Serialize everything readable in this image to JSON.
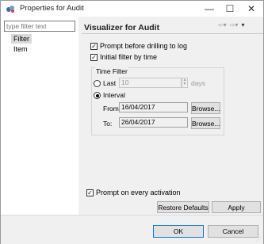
{
  "window": {
    "title": "Properties for Audit",
    "controls": {
      "close_glyph": "✕",
      "maximize_glyph": "☐",
      "minimize_glyph": "—"
    }
  },
  "sidebar": {
    "filter_placeholder": "type filter text",
    "items": [
      {
        "label": "Filter",
        "selected": true
      },
      {
        "label": "Item",
        "selected": false
      }
    ]
  },
  "page": {
    "title": "Visualizer for Audit",
    "options": [
      {
        "label": "Prompt before drilling to log",
        "checked": true
      },
      {
        "label": "Initial filter by time",
        "checked": true
      }
    ],
    "time_filter": {
      "group_label": "Time Filter",
      "last": {
        "label": "Last",
        "selected": false,
        "value": "10",
        "unit": "days"
      },
      "interval": {
        "label": "Interval",
        "selected": true
      },
      "from": {
        "label": "From:",
        "value": "16/04/2017",
        "browse_label": "Browse..."
      },
      "to": {
        "label": "To:",
        "value": "26/04/2017",
        "browse_label": "Browse..."
      }
    },
    "prompt_every_activation": {
      "label": "Prompt on every activation",
      "checked": true
    },
    "restore_defaults_label": "Restore Defaults",
    "apply_label": "Apply"
  },
  "dialog_buttons": {
    "ok_label": "OK",
    "cancel_label": "Cancel"
  },
  "icons": {
    "back": "back-arrow-icon",
    "forward": "forward-arrow-icon",
    "menu": "view-menu-icon"
  },
  "colors": {
    "primary_border": "#0078d7",
    "selection": "#d9d9d9"
  }
}
